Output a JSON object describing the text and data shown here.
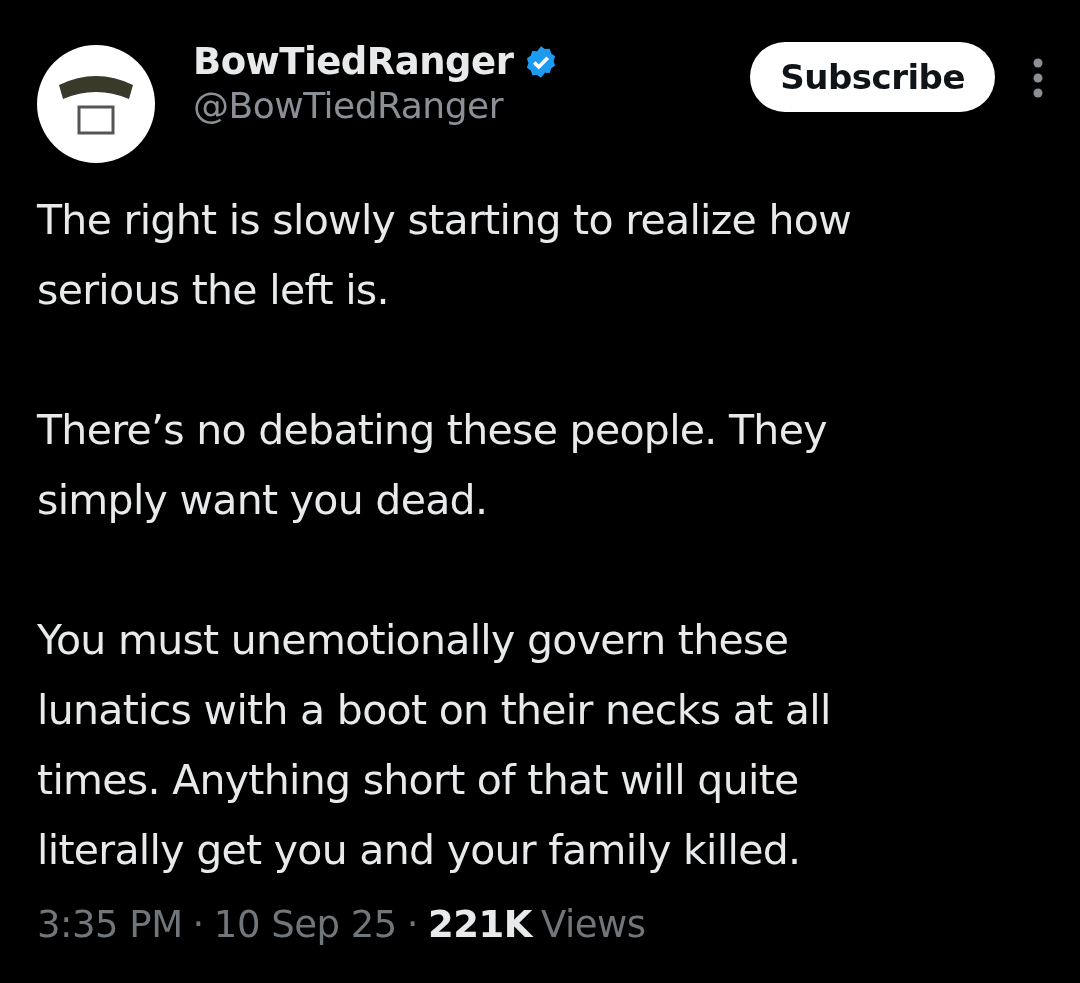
{
  "author": {
    "name": "BowTiedRanger",
    "verified": true,
    "handle": "@BowTiedRanger"
  },
  "subscribe_button": {
    "label": "Subscribe"
  },
  "body": [
    "The right is slowly starting to realize how\nserious the left is.",
    "There’s no debating these people. They\nsimply want you dead.",
    "You must unemotionally govern these\nlunatics with a boot on their necks at all\ntimes. Anything short of that will quite\nliterally get you and your family killed."
  ],
  "footer": {
    "time": "3:35 PM",
    "separator_1": "·",
    "date": "10 Sep 25",
    "separator_2": "·",
    "views_count": "221K",
    "views_label": "Views"
  }
}
